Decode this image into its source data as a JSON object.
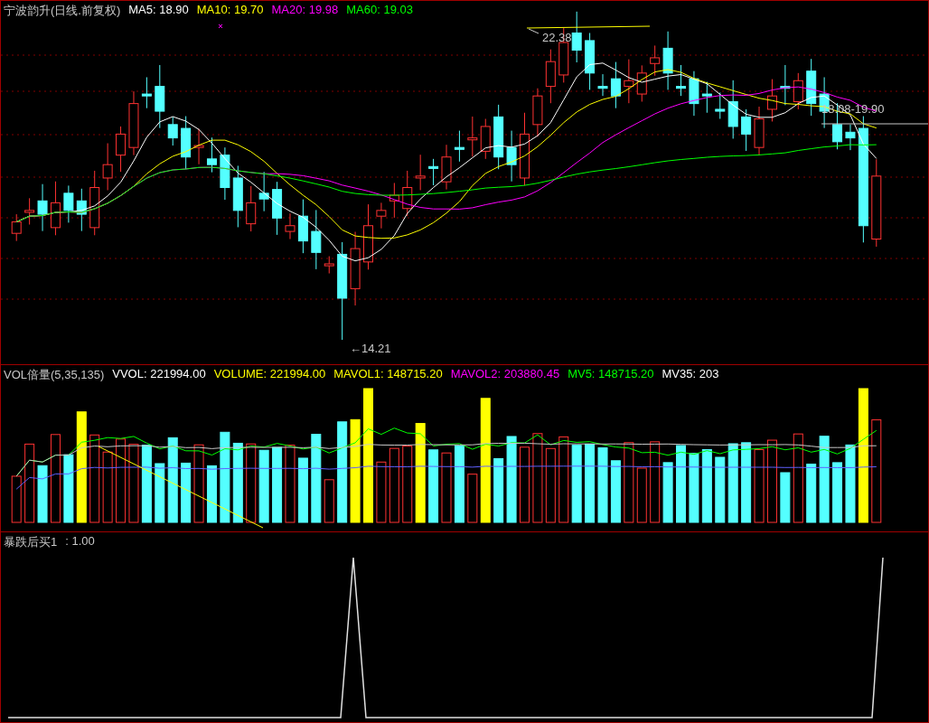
{
  "price_panel": {
    "title": "宁波韵升(日线.前复权)",
    "indicators": [
      {
        "label": "MA5: 18.90",
        "color": "#ffffff"
      },
      {
        "label": "MA10: 19.70",
        "color": "#ffff00"
      },
      {
        "label": "MA20: 19.98",
        "color": "#ff00ff"
      },
      {
        "label": "MA60: 19.03",
        "color": "#00ff00"
      }
    ],
    "labels": [
      {
        "kind": "high",
        "text": "22.38"
      },
      {
        "kind": "low",
        "text": "←14.21"
      },
      {
        "kind": "range",
        "text": "18.08-19.90"
      }
    ]
  },
  "volume_panel": {
    "title": "VOL倍量(5,35,135)",
    "indicators": [
      {
        "label": "VVOL: 221994.00",
        "color": "#ffffff"
      },
      {
        "label": "VOLUME: 221994.00",
        "color": "#ffff00"
      },
      {
        "label": "MAVOL1: 148715.20",
        "color": "#ffff00"
      },
      {
        "label": "MAVOL2: 203880.45",
        "color": "#ff00ff"
      },
      {
        "label": "MV5: 148715.20",
        "color": "#00ff00"
      },
      {
        "label": "MV35: 203",
        "color": "#ffffff"
      }
    ]
  },
  "signal_panel": {
    "title": "暴跌后买1",
    "reading": ": 1.00"
  }
}
